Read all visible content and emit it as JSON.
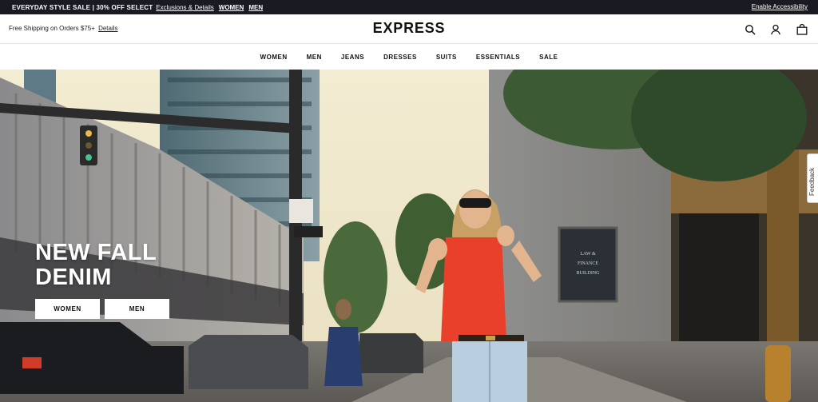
{
  "promo": {
    "sale_text": "EVERYDAY STYLE SALE | 30% OFF SELECT",
    "exclusions_link": "Exclusions & Details",
    "women_link": "WOMEN",
    "men_link": "MEN",
    "accessibility_link": "Enable Accessibility"
  },
  "header": {
    "shipping_text": "Free Shipping on Orders $75+",
    "details_link": "Details",
    "logo": "EXPRESS",
    "icons": [
      "search-icon",
      "account-icon",
      "shopping-bag-icon"
    ]
  },
  "nav": {
    "items": [
      {
        "label": "WOMEN"
      },
      {
        "label": "MEN"
      },
      {
        "label": "JEANS"
      },
      {
        "label": "DRESSES"
      },
      {
        "label": "SUITS"
      },
      {
        "label": "ESSENTIALS"
      },
      {
        "label": "SALE"
      }
    ]
  },
  "hero": {
    "headline_line1": "NEW FALL",
    "headline_line2": "DENIM",
    "cta_women": "WOMEN",
    "cta_men": "MEN",
    "sign_text": "LAW & FINANCE BUILDING"
  },
  "feedback": {
    "label": "Feedback"
  },
  "colors": {
    "promo_bg": "#1a1a22",
    "text": "#111111",
    "accent_top": "#e8402a"
  }
}
